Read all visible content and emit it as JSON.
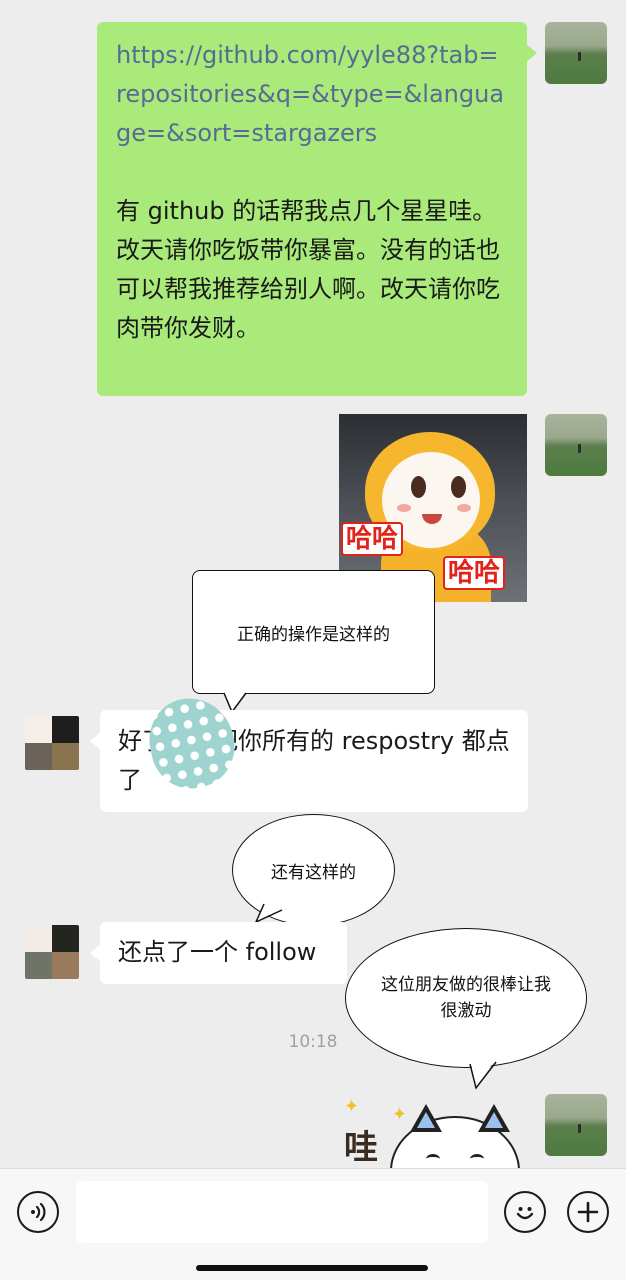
{
  "messages": {
    "link_message": {
      "url": "https://github.com/yyle88?tab=repositories&q=&type=&language=&sort=stargazers",
      "text": "有 github 的话帮我点几个星星哇。改天请你吃饭带你暴富。没有的话也可以帮我推荐给别人啊。改天请你吃肉带你发财。"
    },
    "sticker_mascot": {
      "label_left": "哈哈",
      "label_right": "哈哈"
    },
    "reply_1": {
      "text": "好了，我把你所有的 respostry 都点了"
    },
    "reply_2": {
      "text": "还点了一个 follow"
    },
    "timestamp": "10:18",
    "sticker_cat": {
      "text": "哇"
    }
  },
  "annotations": {
    "callout_1": "正确的操作是这样的",
    "callout_2": "还有这样的",
    "callout_3": "这位朋友做的很棒让我很激动"
  },
  "colors": {
    "background": "#ededed",
    "self_bubble": "#a9ea7a",
    "other_bubble": "#ffffff",
    "link": "#576b95"
  },
  "icons": {
    "voice": "voice-icon",
    "emoji": "emoji-icon",
    "plus": "plus-icon"
  }
}
